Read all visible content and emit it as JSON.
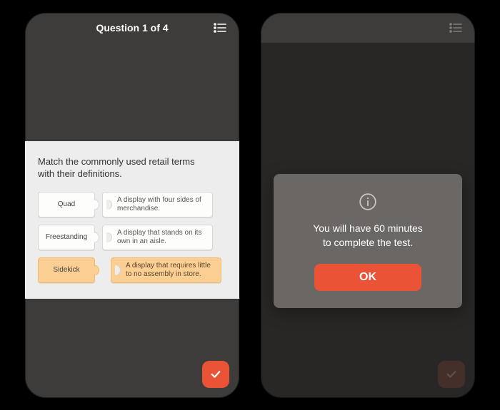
{
  "colors": {
    "accent": "#ea5335",
    "phoneBg": "#3e3c3a",
    "cardBg": "#ecedec"
  },
  "phone1": {
    "header": "Question 1 of 4",
    "prompt": "Match the commonly used retail terms with their definitions.",
    "pairs": [
      {
        "term": "Quad",
        "def": "A display with four sides of merchandise.",
        "selected": false
      },
      {
        "term": "Freestanding",
        "def": "A display that stands on its own in an aisle.",
        "selected": false
      },
      {
        "term": "Sidekick",
        "def": "A display that requires little to no assembly in store.",
        "selected": true
      }
    ]
  },
  "phone2": {
    "header": "",
    "dialog": {
      "line1": "You will have 60 minutes",
      "line2": "to complete the test.",
      "ok": "OK"
    }
  }
}
